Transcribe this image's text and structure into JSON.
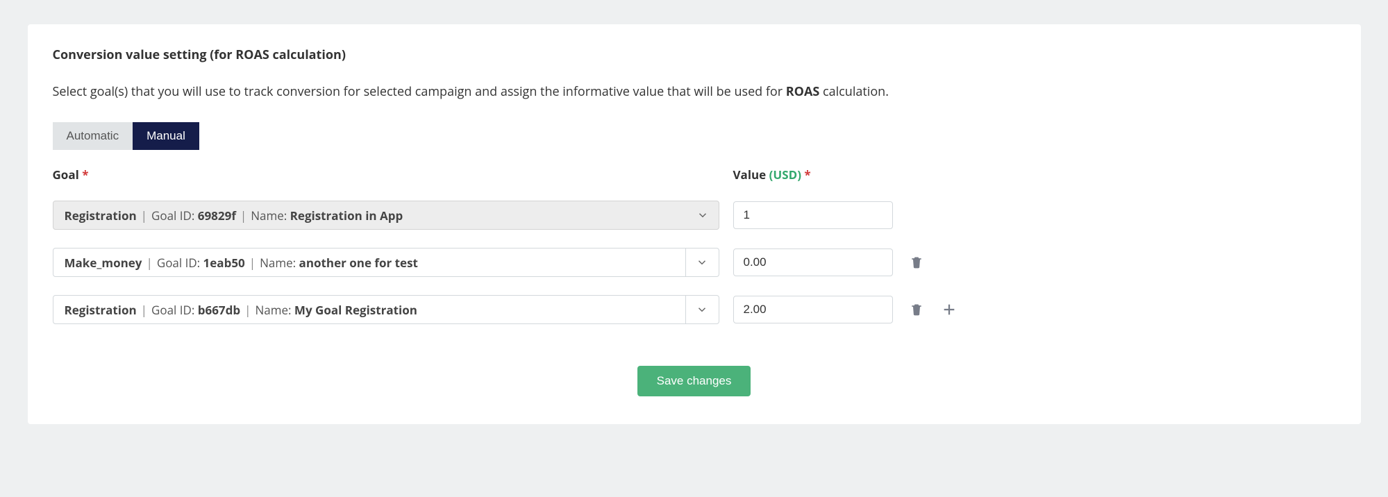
{
  "section_title": "Conversion value setting (for ROAS calculation)",
  "description_pre": "Select goal(s) that you will use to track conversion for selected campaign and assign the informative value that will be used for ",
  "description_bold": "ROAS",
  "description_post": " calculation.",
  "tabs": {
    "automatic": "Automatic",
    "manual": "Manual",
    "active": "manual"
  },
  "labels": {
    "goal": "Goal",
    "value": "Value",
    "currency": "(USD)",
    "required_mark": "*",
    "goal_id_prefix": "Goal ID:",
    "name_prefix": "Name:"
  },
  "rows": [
    {
      "event": "Registration",
      "goal_id": "69829f",
      "goal_name": "Registration in App",
      "value": "1",
      "disabled": true,
      "split_chevron": false,
      "show_delete": false,
      "show_add": false
    },
    {
      "event": "Make_money",
      "goal_id": "1eab50",
      "goal_name": "another one for test",
      "value": "0.00",
      "disabled": false,
      "split_chevron": true,
      "show_delete": true,
      "show_add": false
    },
    {
      "event": "Registration",
      "goal_id": "b667db",
      "goal_name": "My Goal Registration",
      "value": "2.00",
      "disabled": false,
      "split_chevron": true,
      "show_delete": true,
      "show_add": true
    }
  ],
  "buttons": {
    "save": "Save changes"
  }
}
